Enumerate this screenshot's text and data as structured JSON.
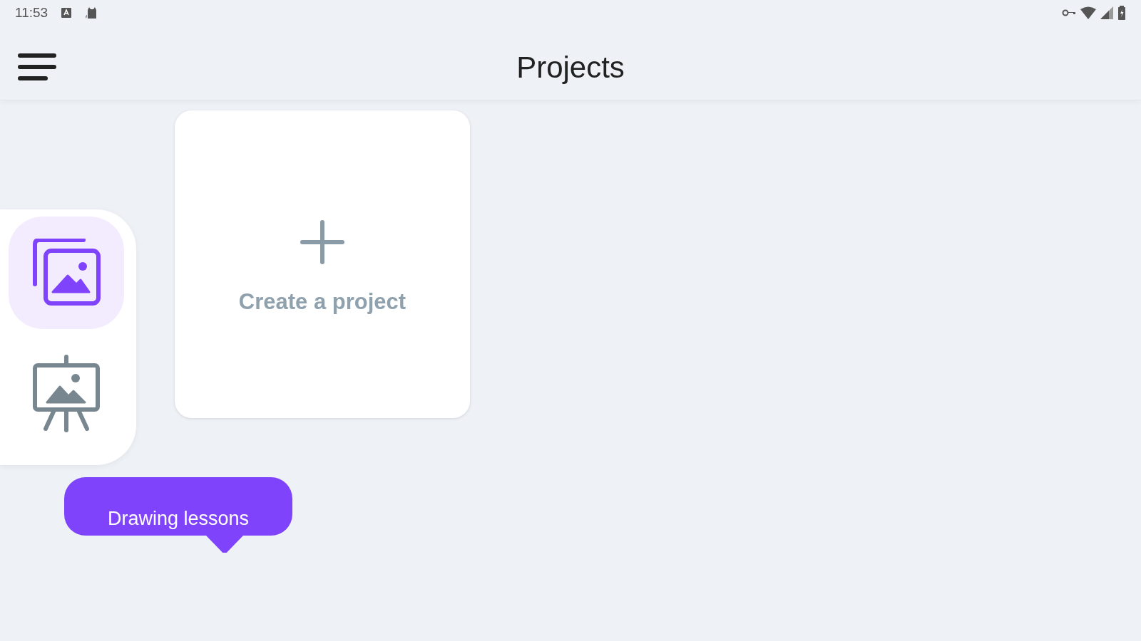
{
  "status_bar": {
    "time": "11:53"
  },
  "header": {
    "title": "Projects"
  },
  "rail": {
    "items": [
      {
        "kind": "gallery",
        "selected": true
      },
      {
        "kind": "easel",
        "selected": false
      }
    ]
  },
  "create_card": {
    "label": "Create a project"
  },
  "tooltip": {
    "text": "Drawing lessons"
  }
}
